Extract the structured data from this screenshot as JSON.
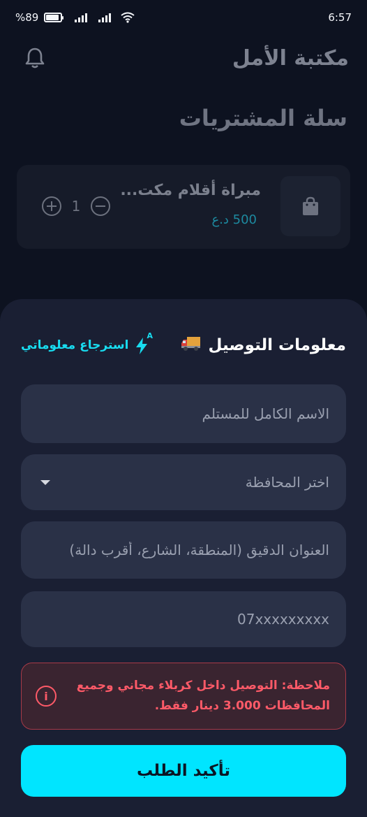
{
  "status_bar": {
    "battery": "%89",
    "time": "6:57",
    "battery_level": 0.89
  },
  "header": {
    "app_title": "مكتبة الأمل",
    "bell_icon": "bell-icon"
  },
  "cart": {
    "title": "سلة المشتريات",
    "items": [
      {
        "name": "مبراة أقلام مكت...",
        "price": "500 د.ع",
        "quantity": "1",
        "icon": "shopping-bag-icon"
      }
    ]
  },
  "delivery": {
    "title": "معلومات التوصيل",
    "title_icon": "truck-icon",
    "restore_label": "استرجاع معلوماتي",
    "restore_icon": "auto-flash-icon",
    "fields": {
      "full_name_placeholder": "الاسم الكامل للمستلم",
      "governorate_placeholder": "اختر المحافظة",
      "address_placeholder": "العنوان الدقيق (المنطقة، الشارع، أقرب دالة)",
      "phone_placeholder": "07xxxxxxxxx"
    },
    "note": "ملاحظة: التوصيل داخل كربلاء مجاني وجميع المحافظات 3.000 دينار فقط.",
    "confirm_label": "تأكيد الطلب"
  },
  "colors": {
    "accent": "#00e5ff",
    "sheet_bg": "#1a1f33",
    "field_bg": "#2a3147",
    "warning": "#ff5a68"
  }
}
